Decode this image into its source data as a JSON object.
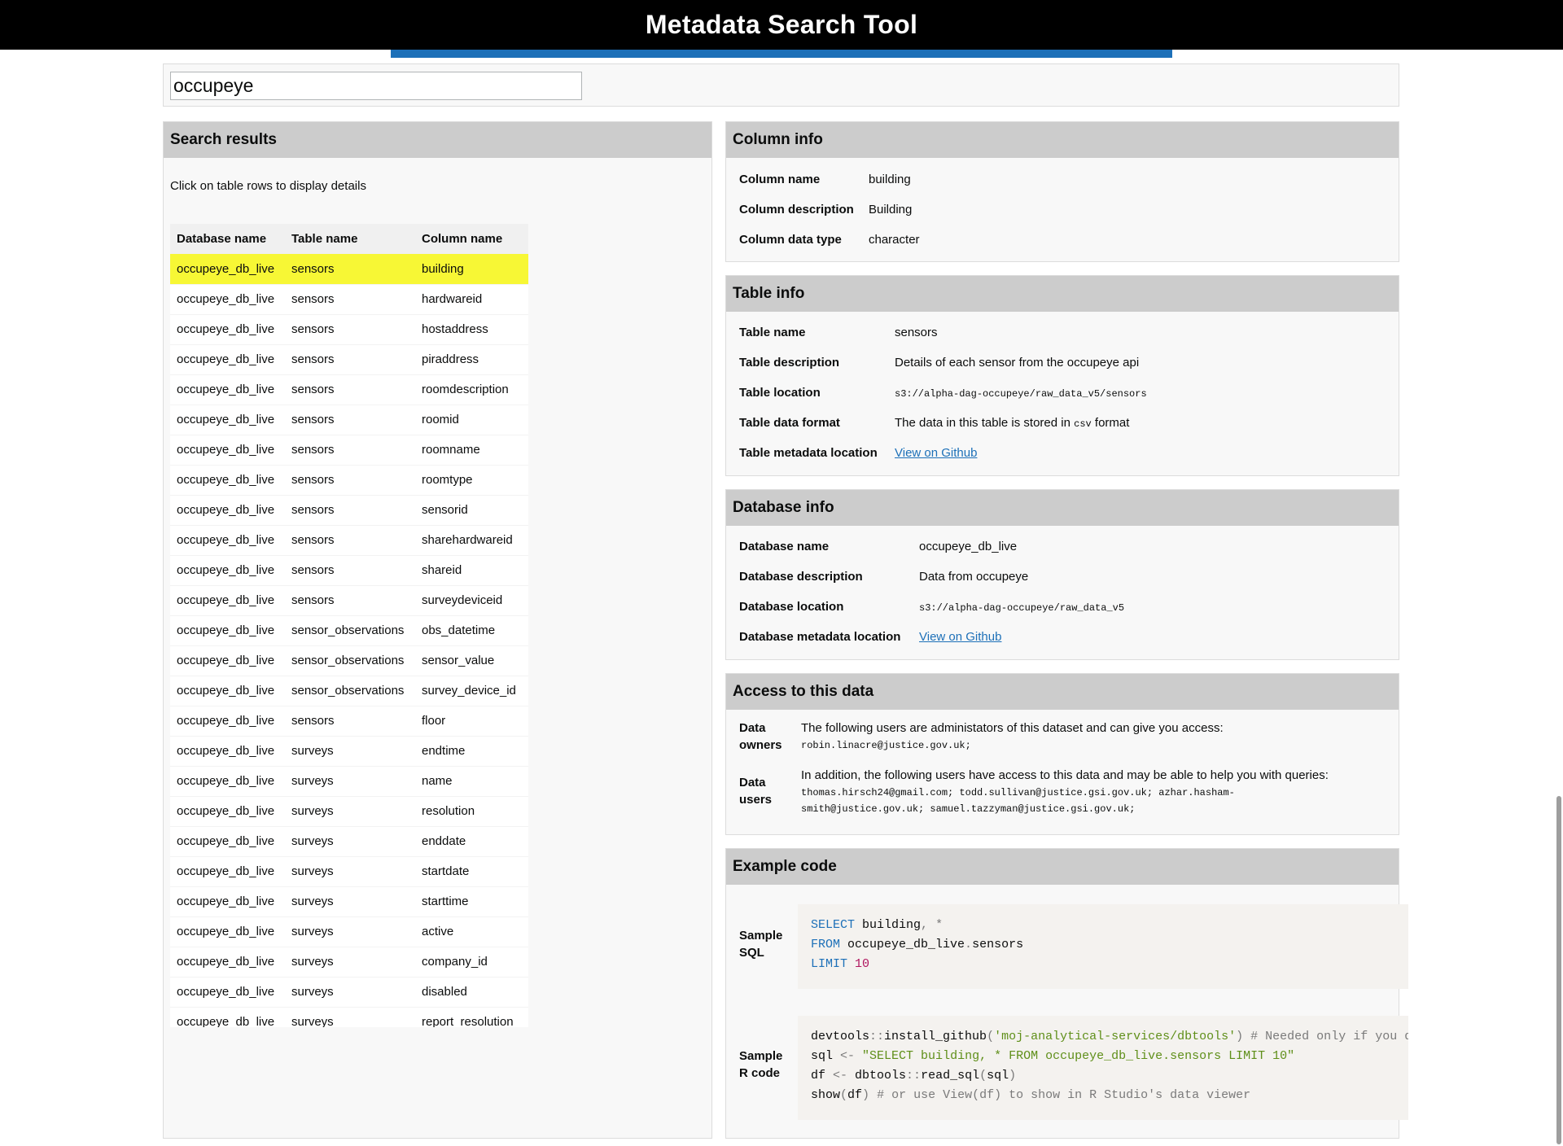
{
  "app": {
    "title": "Metadata Search Tool"
  },
  "search": {
    "value": "occupeye"
  },
  "results": {
    "header": "Search results",
    "hint": "Click on table rows to display details",
    "columns": [
      "Database name",
      "Table name",
      "Column name"
    ],
    "rows": [
      [
        "occupeye_db_live",
        "sensors",
        "building"
      ],
      [
        "occupeye_db_live",
        "sensors",
        "hardwareid"
      ],
      [
        "occupeye_db_live",
        "sensors",
        "hostaddress"
      ],
      [
        "occupeye_db_live",
        "sensors",
        "piraddress"
      ],
      [
        "occupeye_db_live",
        "sensors",
        "roomdescription"
      ],
      [
        "occupeye_db_live",
        "sensors",
        "roomid"
      ],
      [
        "occupeye_db_live",
        "sensors",
        "roomname"
      ],
      [
        "occupeye_db_live",
        "sensors",
        "roomtype"
      ],
      [
        "occupeye_db_live",
        "sensors",
        "sensorid"
      ],
      [
        "occupeye_db_live",
        "sensors",
        "sharehardwareid"
      ],
      [
        "occupeye_db_live",
        "sensors",
        "shareid"
      ],
      [
        "occupeye_db_live",
        "sensors",
        "surveydeviceid"
      ],
      [
        "occupeye_db_live",
        "sensor_observations",
        "obs_datetime"
      ],
      [
        "occupeye_db_live",
        "sensor_observations",
        "sensor_value"
      ],
      [
        "occupeye_db_live",
        "sensor_observations",
        "survey_device_id"
      ],
      [
        "occupeye_db_live",
        "sensors",
        "floor"
      ],
      [
        "occupeye_db_live",
        "surveys",
        "endtime"
      ],
      [
        "occupeye_db_live",
        "surveys",
        "name"
      ],
      [
        "occupeye_db_live",
        "surveys",
        "resolution"
      ],
      [
        "occupeye_db_live",
        "surveys",
        "enddate"
      ],
      [
        "occupeye_db_live",
        "surveys",
        "startdate"
      ],
      [
        "occupeye_db_live",
        "surveys",
        "starttime"
      ],
      [
        "occupeye_db_live",
        "surveys",
        "active"
      ],
      [
        "occupeye_db_live",
        "surveys",
        "company_id"
      ],
      [
        "occupeye_db_live",
        "surveys",
        "disabled"
      ],
      [
        "occupeye_db_live",
        "surveys",
        "report_resolution"
      ]
    ],
    "selected_index": 0
  },
  "column_info": {
    "header": "Column info",
    "name_label": "Column name",
    "name": "building",
    "description_label": "Column description",
    "description": "Building",
    "type_label": "Column data type",
    "type": "character"
  },
  "table_info": {
    "header": "Table info",
    "name_label": "Table name",
    "name": "sensors",
    "description_label": "Table description",
    "description": "Details of each sensor from the occupeye api",
    "location_label": "Table location",
    "location": "s3://alpha-dag-occupeye/raw_data_v5/sensors",
    "format_label": "Table data format",
    "format_prefix": "The data in this table is stored in",
    "format": "csv",
    "format_suffix": "format",
    "metadata_label": "Table metadata location",
    "metadata_link": "View on Github"
  },
  "database_info": {
    "header": "Database info",
    "name_label": "Database name",
    "name": "occupeye_db_live",
    "description_label": "Database description",
    "description": "Data from occupeye",
    "location_label": "Database location",
    "location": "s3://alpha-dag-occupeye/raw_data_v5",
    "metadata_label": "Database metadata location",
    "metadata_link": "View on Github"
  },
  "access": {
    "header": "Access to this data",
    "owners_label_1": "Data",
    "owners_label_2": "owners",
    "owners_text": "The following users are administators of this dataset and can give you access:",
    "owners_emails": "robin.linacre@justice.gov.uk;",
    "users_label_1": "Data",
    "users_label_2": "users",
    "users_text": "In addition, the following users have access to this data and may be able to help you with queries:",
    "users_emails_1": "thomas.hirsch24@gmail.com;  todd.sullivan@justice.gsi.gov.uk;  azhar.hasham-",
    "users_emails_2": "smith@justice.gov.uk;  samuel.tazzyman@justice.gsi.gov.uk;"
  },
  "example": {
    "header": "Example code",
    "sql_label_1": "Sample",
    "sql_label_2": "SQL",
    "r_label_1": "Sample",
    "r_label_2": "R code"
  }
}
